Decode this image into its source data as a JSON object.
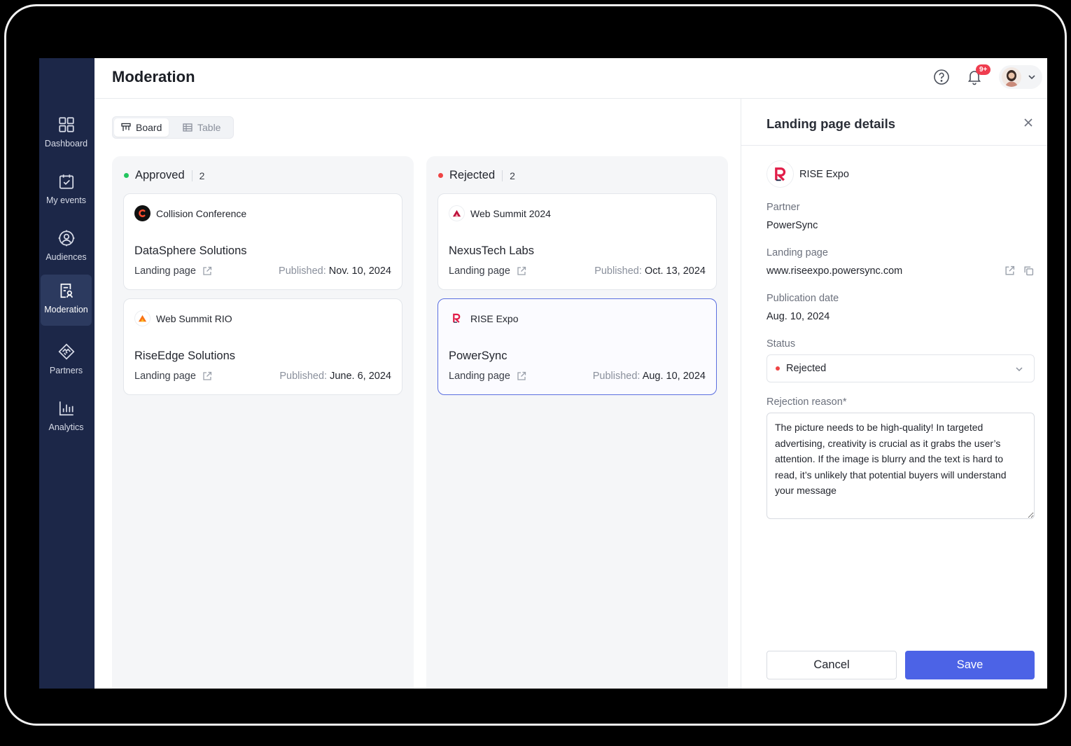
{
  "header": {
    "title": "Moderation",
    "notifications_badge": "9+"
  },
  "sidebar": {
    "items": [
      {
        "label": "Dashboard",
        "icon": "dashboard-icon"
      },
      {
        "label": "My events",
        "icon": "calendar-check-icon"
      },
      {
        "label": "Audiences",
        "icon": "audiences-icon"
      },
      {
        "label": "Moderation",
        "icon": "moderation-icon",
        "active": true
      },
      {
        "label": "Partners",
        "icon": "handshake-icon"
      },
      {
        "label": "Analytics",
        "icon": "bar-chart-icon"
      }
    ]
  },
  "view_toggle": {
    "board": "Board",
    "table": "Table",
    "selected": "Board"
  },
  "columns": [
    {
      "title": "Approved",
      "count": "2",
      "color": "#22c55e",
      "cards": [
        {
          "event": "Collision Conference",
          "partner": "DataSphere Solutions",
          "link": "Landing page",
          "published_label": "Published:",
          "published_date": "Nov. 10, 2024"
        },
        {
          "event": "Web Summit RIO",
          "partner": "RiseEdge Solutions",
          "link": "Landing page",
          "published_label": "Published:",
          "published_date": "June. 6, 2024"
        }
      ]
    },
    {
      "title": "Rejected",
      "count": "2",
      "color": "#ef4444",
      "cards": [
        {
          "event": "Web Summit 2024",
          "partner": "NexusTech Labs",
          "link": "Landing page",
          "published_label": "Published:",
          "published_date": "Oct. 13, 2024"
        },
        {
          "event": "RISE Expo",
          "partner": "PowerSync",
          "link": "Landing page",
          "published_label": "Published:",
          "published_date": "Aug. 10, 2024",
          "selected": true
        }
      ]
    }
  ],
  "details": {
    "title": "Landing page details",
    "event": "RISE Expo",
    "partner_label": "Partner",
    "partner": "PowerSync",
    "landing_label": "Landing page",
    "landing_url": "www.riseexpo.powersync.com",
    "date_label": "Publication date",
    "date": "Aug. 10, 2024",
    "status_label": "Status",
    "status": "Rejected",
    "status_color": "#ef4444",
    "reason_label": "Rejection reason*",
    "reason": "The picture needs to be high-quality! In targeted advertising, creativity is crucial as it grabs the user’s attention. If the image is blurry and the text is hard to read, it’s unlikely that potential buyers will understand your message",
    "cancel": "Cancel",
    "save": "Save"
  },
  "colors": {
    "sidebar": "#1c2748",
    "accent": "#4c63e6",
    "brand_red": "#e11d48"
  }
}
